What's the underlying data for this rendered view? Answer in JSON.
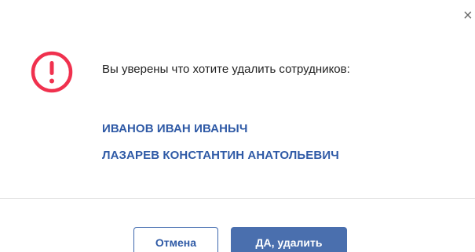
{
  "dialog": {
    "close_label": "×",
    "message": "Вы уверены что хотите удалить сотрудников:",
    "employees": [
      "ИВАНОВ ИВАН ИВАНЫЧ",
      "ЛАЗАРЕВ КОНСТАНТИН АНАТОЛЬЕВИЧ"
    ],
    "warning_icon": "exclamation-circle-icon",
    "cancel_label": "Отмена",
    "confirm_label": "ДА, удалить"
  },
  "colors": {
    "warning": "#f0314e",
    "accent": "#2f5aa6",
    "confirm_bg": "#4a6fae",
    "divider": "#e2e2e2"
  }
}
